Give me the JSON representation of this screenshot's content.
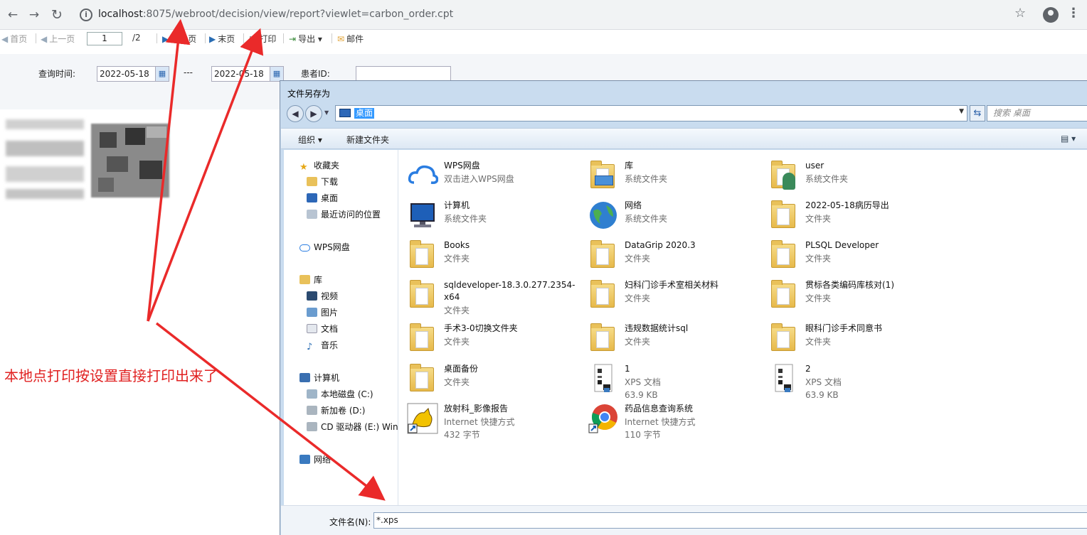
{
  "browser": {
    "url_host": "localhost",
    "url_rest": ":8075/webroot/decision/view/report?viewlet=carbon_order.cpt",
    "back": "←",
    "forward": "→",
    "reload": "↻",
    "star": "☆",
    "menu": "⋮"
  },
  "toolbar": {
    "first": "首页",
    "prev": "上一页",
    "page_value": "1",
    "page_total": "/2",
    "next": "下一页",
    "last": "末页",
    "print": "打印",
    "export": "导出",
    "mail": "邮件"
  },
  "query": {
    "time_label": "查询时间:",
    "start_date": "2022-05-18",
    "separator": "---",
    "end_date": "2022-05-18",
    "patient_label": "患者ID:"
  },
  "annotation": "本地点打印按设置直接打印出来了",
  "dialog": {
    "title": "文件另存为",
    "address": "桌面",
    "search_placeholder": "搜索 桌面",
    "organize": "组织 ▾",
    "new_folder": "新建文件夹",
    "filename_label": "文件名(N):",
    "filename_value": "*.xps",
    "nav": {
      "favorites": "收藏夹",
      "downloads": "下载",
      "desktop": "桌面",
      "recent": "最近访问的位置",
      "wps": "WPS网盘",
      "library": "库",
      "video": "视频",
      "pictures": "图片",
      "docs": "文档",
      "music": "音乐",
      "computer": "计算机",
      "disk_c": "本地磁盘 (C:)",
      "disk_d": "新加卷 (D:)",
      "disk_e": "CD 驱动器 (E:) Win",
      "network": "网络"
    },
    "files": [
      {
        "name": "WPS网盘",
        "sub1": "双击进入WPS网盘",
        "sub2": "",
        "icon": "cloud-icon"
      },
      {
        "name": "库",
        "sub1": "系统文件夹",
        "sub2": "",
        "icon": "library-icon"
      },
      {
        "name": "user",
        "sub1": "系统文件夹",
        "sub2": "",
        "icon": "user-folder-icon"
      },
      {
        "name": "计算机",
        "sub1": "系统文件夹",
        "sub2": "",
        "icon": "computer-icon"
      },
      {
        "name": "网络",
        "sub1": "系统文件夹",
        "sub2": "",
        "icon": "network-icon"
      },
      {
        "name": "2022-05-18病历导出",
        "sub1": "文件夹",
        "sub2": "",
        "icon": "folder-icon"
      },
      {
        "name": "Books",
        "sub1": "文件夹",
        "sub2": "",
        "icon": "folder-icon"
      },
      {
        "name": "DataGrip 2020.3",
        "sub1": "文件夹",
        "sub2": "",
        "icon": "folder-icon"
      },
      {
        "name": "PLSQL Developer",
        "sub1": "文件夹",
        "sub2": "",
        "icon": "folder-icon"
      },
      {
        "name": "sqldeveloper-18.3.0.277.2354-x64",
        "sub1": "文件夹",
        "sub2": "",
        "icon": "folder-icon"
      },
      {
        "name": "妇科门诊手术室相关材料",
        "sub1": "文件夹",
        "sub2": "",
        "icon": "folder-icon"
      },
      {
        "name": "贯标各类编码库核对(1)",
        "sub1": "文件夹",
        "sub2": "",
        "icon": "folder-icon"
      },
      {
        "name": "手术3-0切换文件夹",
        "sub1": "文件夹",
        "sub2": "",
        "icon": "folder-icon"
      },
      {
        "name": "违规数据统计sql",
        "sub1": "文件夹",
        "sub2": "",
        "icon": "folder-icon"
      },
      {
        "name": "眼科门诊手术同意书",
        "sub1": "文件夹",
        "sub2": "",
        "icon": "folder-icon"
      },
      {
        "name": "桌面备份",
        "sub1": "文件夹",
        "sub2": "",
        "icon": "folder-icon"
      },
      {
        "name": "1",
        "sub1": "XPS 文档",
        "sub2": "63.9 KB",
        "icon": "xps-icon"
      },
      {
        "name": "2",
        "sub1": "XPS 文档",
        "sub2": "63.9 KB",
        "icon": "xps-icon"
      },
      {
        "name": "放射科_影像报告",
        "sub1": "Internet 快捷方式",
        "sub2": "432 字节",
        "icon": "tomcat-shortcut-icon"
      },
      {
        "name": "药品信息查询系统",
        "sub1": "Internet 快捷方式",
        "sub2": "110 字节",
        "icon": "chrome-shortcut-icon"
      }
    ]
  }
}
